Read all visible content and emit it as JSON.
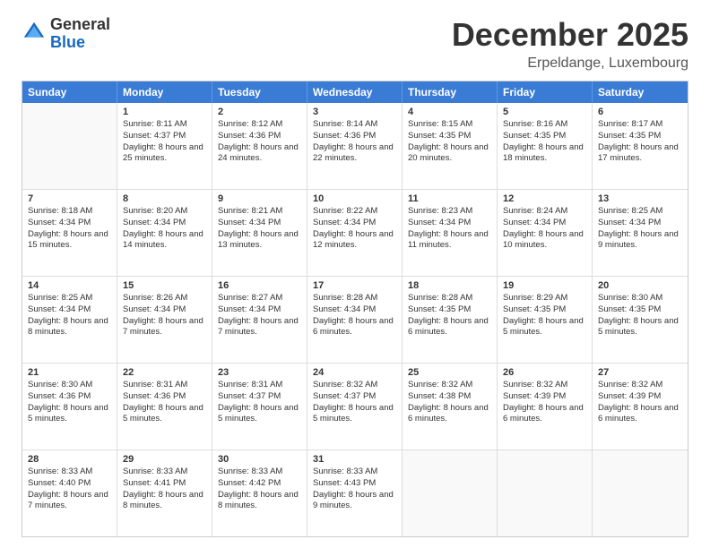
{
  "header": {
    "logo": {
      "general": "General",
      "blue": "Blue"
    },
    "title": "December 2025",
    "location": "Erpeldange, Luxembourg"
  },
  "calendar": {
    "days": [
      "Sunday",
      "Monday",
      "Tuesday",
      "Wednesday",
      "Thursday",
      "Friday",
      "Saturday"
    ],
    "rows": [
      [
        {
          "day": "",
          "empty": true
        },
        {
          "day": "1",
          "sunrise": "Sunrise: 8:11 AM",
          "sunset": "Sunset: 4:37 PM",
          "daylight": "Daylight: 8 hours and 25 minutes."
        },
        {
          "day": "2",
          "sunrise": "Sunrise: 8:12 AM",
          "sunset": "Sunset: 4:36 PM",
          "daylight": "Daylight: 8 hours and 24 minutes."
        },
        {
          "day": "3",
          "sunrise": "Sunrise: 8:14 AM",
          "sunset": "Sunset: 4:36 PM",
          "daylight": "Daylight: 8 hours and 22 minutes."
        },
        {
          "day": "4",
          "sunrise": "Sunrise: 8:15 AM",
          "sunset": "Sunset: 4:35 PM",
          "daylight": "Daylight: 8 hours and 20 minutes."
        },
        {
          "day": "5",
          "sunrise": "Sunrise: 8:16 AM",
          "sunset": "Sunset: 4:35 PM",
          "daylight": "Daylight: 8 hours and 18 minutes."
        },
        {
          "day": "6",
          "sunrise": "Sunrise: 8:17 AM",
          "sunset": "Sunset: 4:35 PM",
          "daylight": "Daylight: 8 hours and 17 minutes."
        }
      ],
      [
        {
          "day": "7",
          "sunrise": "Sunrise: 8:18 AM",
          "sunset": "Sunset: 4:34 PM",
          "daylight": "Daylight: 8 hours and 15 minutes."
        },
        {
          "day": "8",
          "sunrise": "Sunrise: 8:20 AM",
          "sunset": "Sunset: 4:34 PM",
          "daylight": "Daylight: 8 hours and 14 minutes."
        },
        {
          "day": "9",
          "sunrise": "Sunrise: 8:21 AM",
          "sunset": "Sunset: 4:34 PM",
          "daylight": "Daylight: 8 hours and 13 minutes."
        },
        {
          "day": "10",
          "sunrise": "Sunrise: 8:22 AM",
          "sunset": "Sunset: 4:34 PM",
          "daylight": "Daylight: 8 hours and 12 minutes."
        },
        {
          "day": "11",
          "sunrise": "Sunrise: 8:23 AM",
          "sunset": "Sunset: 4:34 PM",
          "daylight": "Daylight: 8 hours and 11 minutes."
        },
        {
          "day": "12",
          "sunrise": "Sunrise: 8:24 AM",
          "sunset": "Sunset: 4:34 PM",
          "daylight": "Daylight: 8 hours and 10 minutes."
        },
        {
          "day": "13",
          "sunrise": "Sunrise: 8:25 AM",
          "sunset": "Sunset: 4:34 PM",
          "daylight": "Daylight: 8 hours and 9 minutes."
        }
      ],
      [
        {
          "day": "14",
          "sunrise": "Sunrise: 8:25 AM",
          "sunset": "Sunset: 4:34 PM",
          "daylight": "Daylight: 8 hours and 8 minutes."
        },
        {
          "day": "15",
          "sunrise": "Sunrise: 8:26 AM",
          "sunset": "Sunset: 4:34 PM",
          "daylight": "Daylight: 8 hours and 7 minutes."
        },
        {
          "day": "16",
          "sunrise": "Sunrise: 8:27 AM",
          "sunset": "Sunset: 4:34 PM",
          "daylight": "Daylight: 8 hours and 7 minutes."
        },
        {
          "day": "17",
          "sunrise": "Sunrise: 8:28 AM",
          "sunset": "Sunset: 4:34 PM",
          "daylight": "Daylight: 8 hours and 6 minutes."
        },
        {
          "day": "18",
          "sunrise": "Sunrise: 8:28 AM",
          "sunset": "Sunset: 4:35 PM",
          "daylight": "Daylight: 8 hours and 6 minutes."
        },
        {
          "day": "19",
          "sunrise": "Sunrise: 8:29 AM",
          "sunset": "Sunset: 4:35 PM",
          "daylight": "Daylight: 8 hours and 5 minutes."
        },
        {
          "day": "20",
          "sunrise": "Sunrise: 8:30 AM",
          "sunset": "Sunset: 4:35 PM",
          "daylight": "Daylight: 8 hours and 5 minutes."
        }
      ],
      [
        {
          "day": "21",
          "sunrise": "Sunrise: 8:30 AM",
          "sunset": "Sunset: 4:36 PM",
          "daylight": "Daylight: 8 hours and 5 minutes."
        },
        {
          "day": "22",
          "sunrise": "Sunrise: 8:31 AM",
          "sunset": "Sunset: 4:36 PM",
          "daylight": "Daylight: 8 hours and 5 minutes."
        },
        {
          "day": "23",
          "sunrise": "Sunrise: 8:31 AM",
          "sunset": "Sunset: 4:37 PM",
          "daylight": "Daylight: 8 hours and 5 minutes."
        },
        {
          "day": "24",
          "sunrise": "Sunrise: 8:32 AM",
          "sunset": "Sunset: 4:37 PM",
          "daylight": "Daylight: 8 hours and 5 minutes."
        },
        {
          "day": "25",
          "sunrise": "Sunrise: 8:32 AM",
          "sunset": "Sunset: 4:38 PM",
          "daylight": "Daylight: 8 hours and 6 minutes."
        },
        {
          "day": "26",
          "sunrise": "Sunrise: 8:32 AM",
          "sunset": "Sunset: 4:39 PM",
          "daylight": "Daylight: 8 hours and 6 minutes."
        },
        {
          "day": "27",
          "sunrise": "Sunrise: 8:32 AM",
          "sunset": "Sunset: 4:39 PM",
          "daylight": "Daylight: 8 hours and 6 minutes."
        }
      ],
      [
        {
          "day": "28",
          "sunrise": "Sunrise: 8:33 AM",
          "sunset": "Sunset: 4:40 PM",
          "daylight": "Daylight: 8 hours and 7 minutes."
        },
        {
          "day": "29",
          "sunrise": "Sunrise: 8:33 AM",
          "sunset": "Sunset: 4:41 PM",
          "daylight": "Daylight: 8 hours and 8 minutes."
        },
        {
          "day": "30",
          "sunrise": "Sunrise: 8:33 AM",
          "sunset": "Sunset: 4:42 PM",
          "daylight": "Daylight: 8 hours and 8 minutes."
        },
        {
          "day": "31",
          "sunrise": "Sunrise: 8:33 AM",
          "sunset": "Sunset: 4:43 PM",
          "daylight": "Daylight: 8 hours and 9 minutes."
        },
        {
          "day": "",
          "empty": true
        },
        {
          "day": "",
          "empty": true
        },
        {
          "day": "",
          "empty": true
        }
      ]
    ]
  }
}
